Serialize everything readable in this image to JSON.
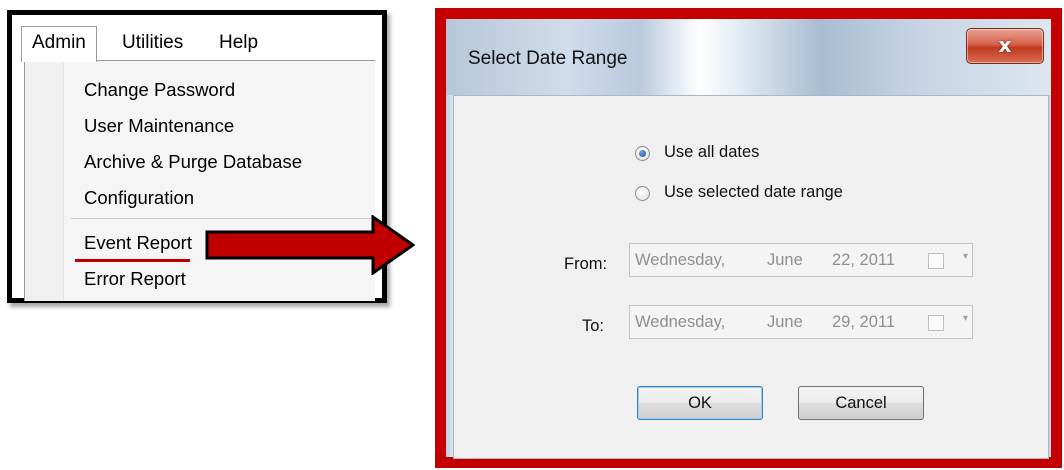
{
  "menu": {
    "bar": [
      "Admin",
      "Utilities",
      "Help"
    ],
    "items": [
      "Change Password",
      "User Maintenance",
      "Archive & Purge Database",
      "Configuration",
      "Event Report",
      "Error Report"
    ],
    "highlighted_item": "Event Report",
    "highlight_color": "#c00000"
  },
  "dialog": {
    "title": "Select Date Range",
    "close_symbol": "x",
    "radios": [
      {
        "label": "Use all dates",
        "selected": true
      },
      {
        "label": "Use selected date range",
        "selected": false
      }
    ],
    "from": {
      "label": "From:",
      "weekday": "Wednesday,",
      "month": "June",
      "day_year": "22, 2011"
    },
    "to": {
      "label": "To:",
      "weekday": "Wednesday,",
      "month": "June",
      "day_year": "29, 2011"
    },
    "ok_label": "OK",
    "cancel_label": "Cancel",
    "frame_color": "#c40000"
  }
}
